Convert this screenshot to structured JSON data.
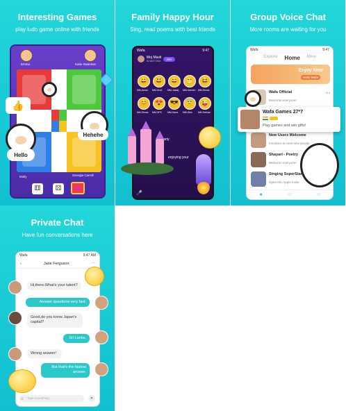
{
  "panels": {
    "games": {
      "title": "Interesting Games",
      "subtitle": "play ludo game online with friends",
      "players": {
        "top_left": "Emma",
        "top_right": "Katie Swanson",
        "bottom_left": "Molly",
        "bottom_right": "Georgia Carroll"
      },
      "bubble_hello": "Hello",
      "bubble_hehehe": "Hehehe"
    },
    "party": {
      "title": "Family Happy Hour",
      "subtitle": "Sing, read poems with best friends",
      "room_name": "Moj Masti",
      "room_id": "ID:16277244",
      "join_label": "Join",
      "seats": [
        "MM-Aman",
        "MM-DUA",
        "MM-Jakarj",
        "MM-Noreen",
        "MM-Elmaz",
        "MM-Elmaz",
        "MM-SPK",
        "MM-Sana",
        "MM-Shiv",
        "MM-Sehian"
      ],
      "party_text": "Party",
      "enjoy_text": "enjoying your"
    },
    "voice": {
      "title": "Group Voice Chat",
      "subtitle": "More rooms are waiting for you",
      "tabs": [
        "Explore",
        "Home",
        "Mine"
      ],
      "active_tab": "Home",
      "banner_title": "Enjoy time",
      "banner_sub": "Hello Wafa",
      "rooms": [
        {
          "name": "Wafa Official",
          "desc": "Welcome everyone!",
          "count": "113"
        },
        {
          "name": "New Users Welcome",
          "desc": "Introduce & meet new people",
          "count": ""
        },
        {
          "name": "Shayari - Poetry",
          "desc": "Welcome everyone!",
          "count": ""
        },
        {
          "name": "Singing SuperStar",
          "desc": "Open Mic  Apple Invite",
          "count": ""
        }
      ],
      "card_title": "Wafa Games 27*7",
      "card_sub": "Play games and win gifts!"
    },
    "chat": {
      "title": "Private Chat",
      "subtitle": "Have fun conversations here",
      "contact": "Jane Ferguson",
      "messages": [
        {
          "dir": "in",
          "text": "Hi,there.What's your talent?"
        },
        {
          "dir": "out",
          "text": "Answer questions very fast."
        },
        {
          "dir": "in",
          "text": "Good,do you konw Japan's capital?"
        },
        {
          "dir": "out",
          "text": "Sri Lanka."
        },
        {
          "dir": "in",
          "text": "Wrong answer!"
        },
        {
          "dir": "out",
          "text": "But that's the fastest answer."
        }
      ],
      "input_placeholder": "Type something..."
    }
  },
  "colors": {
    "teal_bg": "#1ccdd6",
    "bubble_out": "#2ac8c9",
    "accent_orange": "#f6a35d"
  }
}
